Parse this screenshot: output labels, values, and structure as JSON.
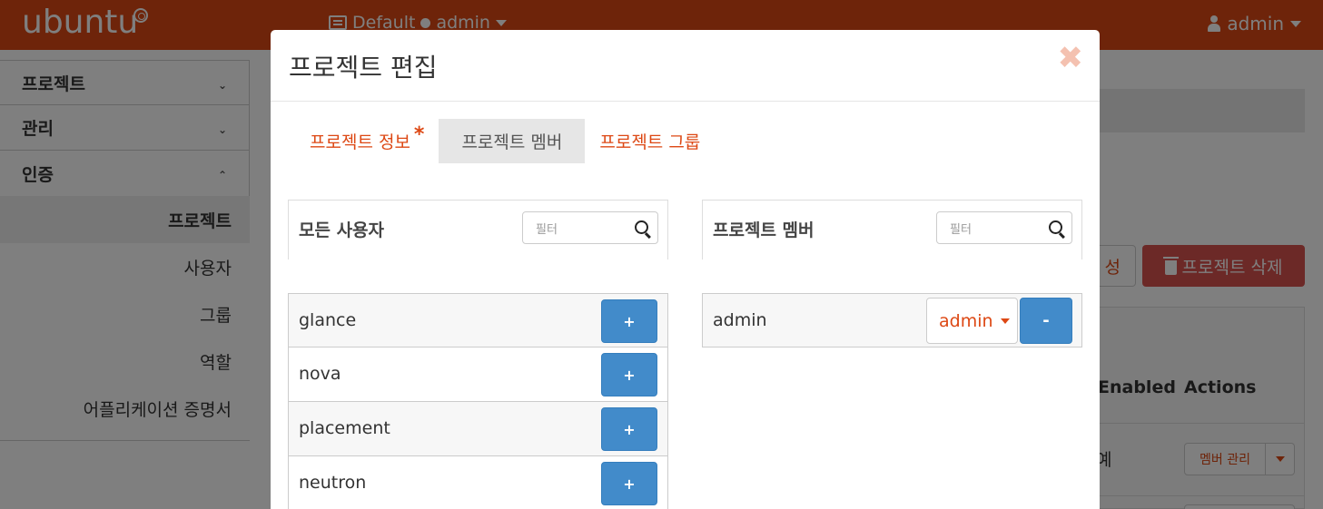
{
  "topbar": {
    "logo": "ubuntu",
    "project_switch": {
      "domain": "Default",
      "project": "admin"
    },
    "user": "admin"
  },
  "sidebar": {
    "sections": [
      {
        "label": "프로젝트",
        "chevron": "⌄"
      },
      {
        "label": "관리",
        "chevron": "⌄"
      },
      {
        "label": "인증",
        "chevron": "⌃"
      }
    ],
    "items": [
      "프로젝트",
      "사용자",
      "그룹",
      "역할",
      "어플리케이션 증명서"
    ]
  },
  "background": {
    "create_partial": "성",
    "delete_button": "프로젝트 삭제",
    "table_headers": {
      "enabled": "Enabled",
      "actions": "Actions"
    },
    "row_partial": "예",
    "manage_members": "멤버 관리"
  },
  "modal": {
    "title": "프로젝트 편집",
    "close": "✖",
    "tabs": [
      {
        "label": "프로젝트 정보",
        "required_mark": "*"
      },
      {
        "label": "프로젝트 멤버"
      },
      {
        "label": "프로젝트 그룹"
      }
    ],
    "all_users": {
      "title": "모든 사용자",
      "filter_placeholder": "필터",
      "users": [
        "glance",
        "nova",
        "placement",
        "neutron"
      ],
      "add_label": "+"
    },
    "project_members": {
      "title": "프로젝트 멤버",
      "filter_placeholder": "필터",
      "members": [
        {
          "name": "admin",
          "role": "admin"
        }
      ],
      "remove_label": "-"
    }
  },
  "colors": {
    "brand": "#dd4814",
    "primary_button": "#428bca",
    "danger_button": "#d9534f"
  }
}
